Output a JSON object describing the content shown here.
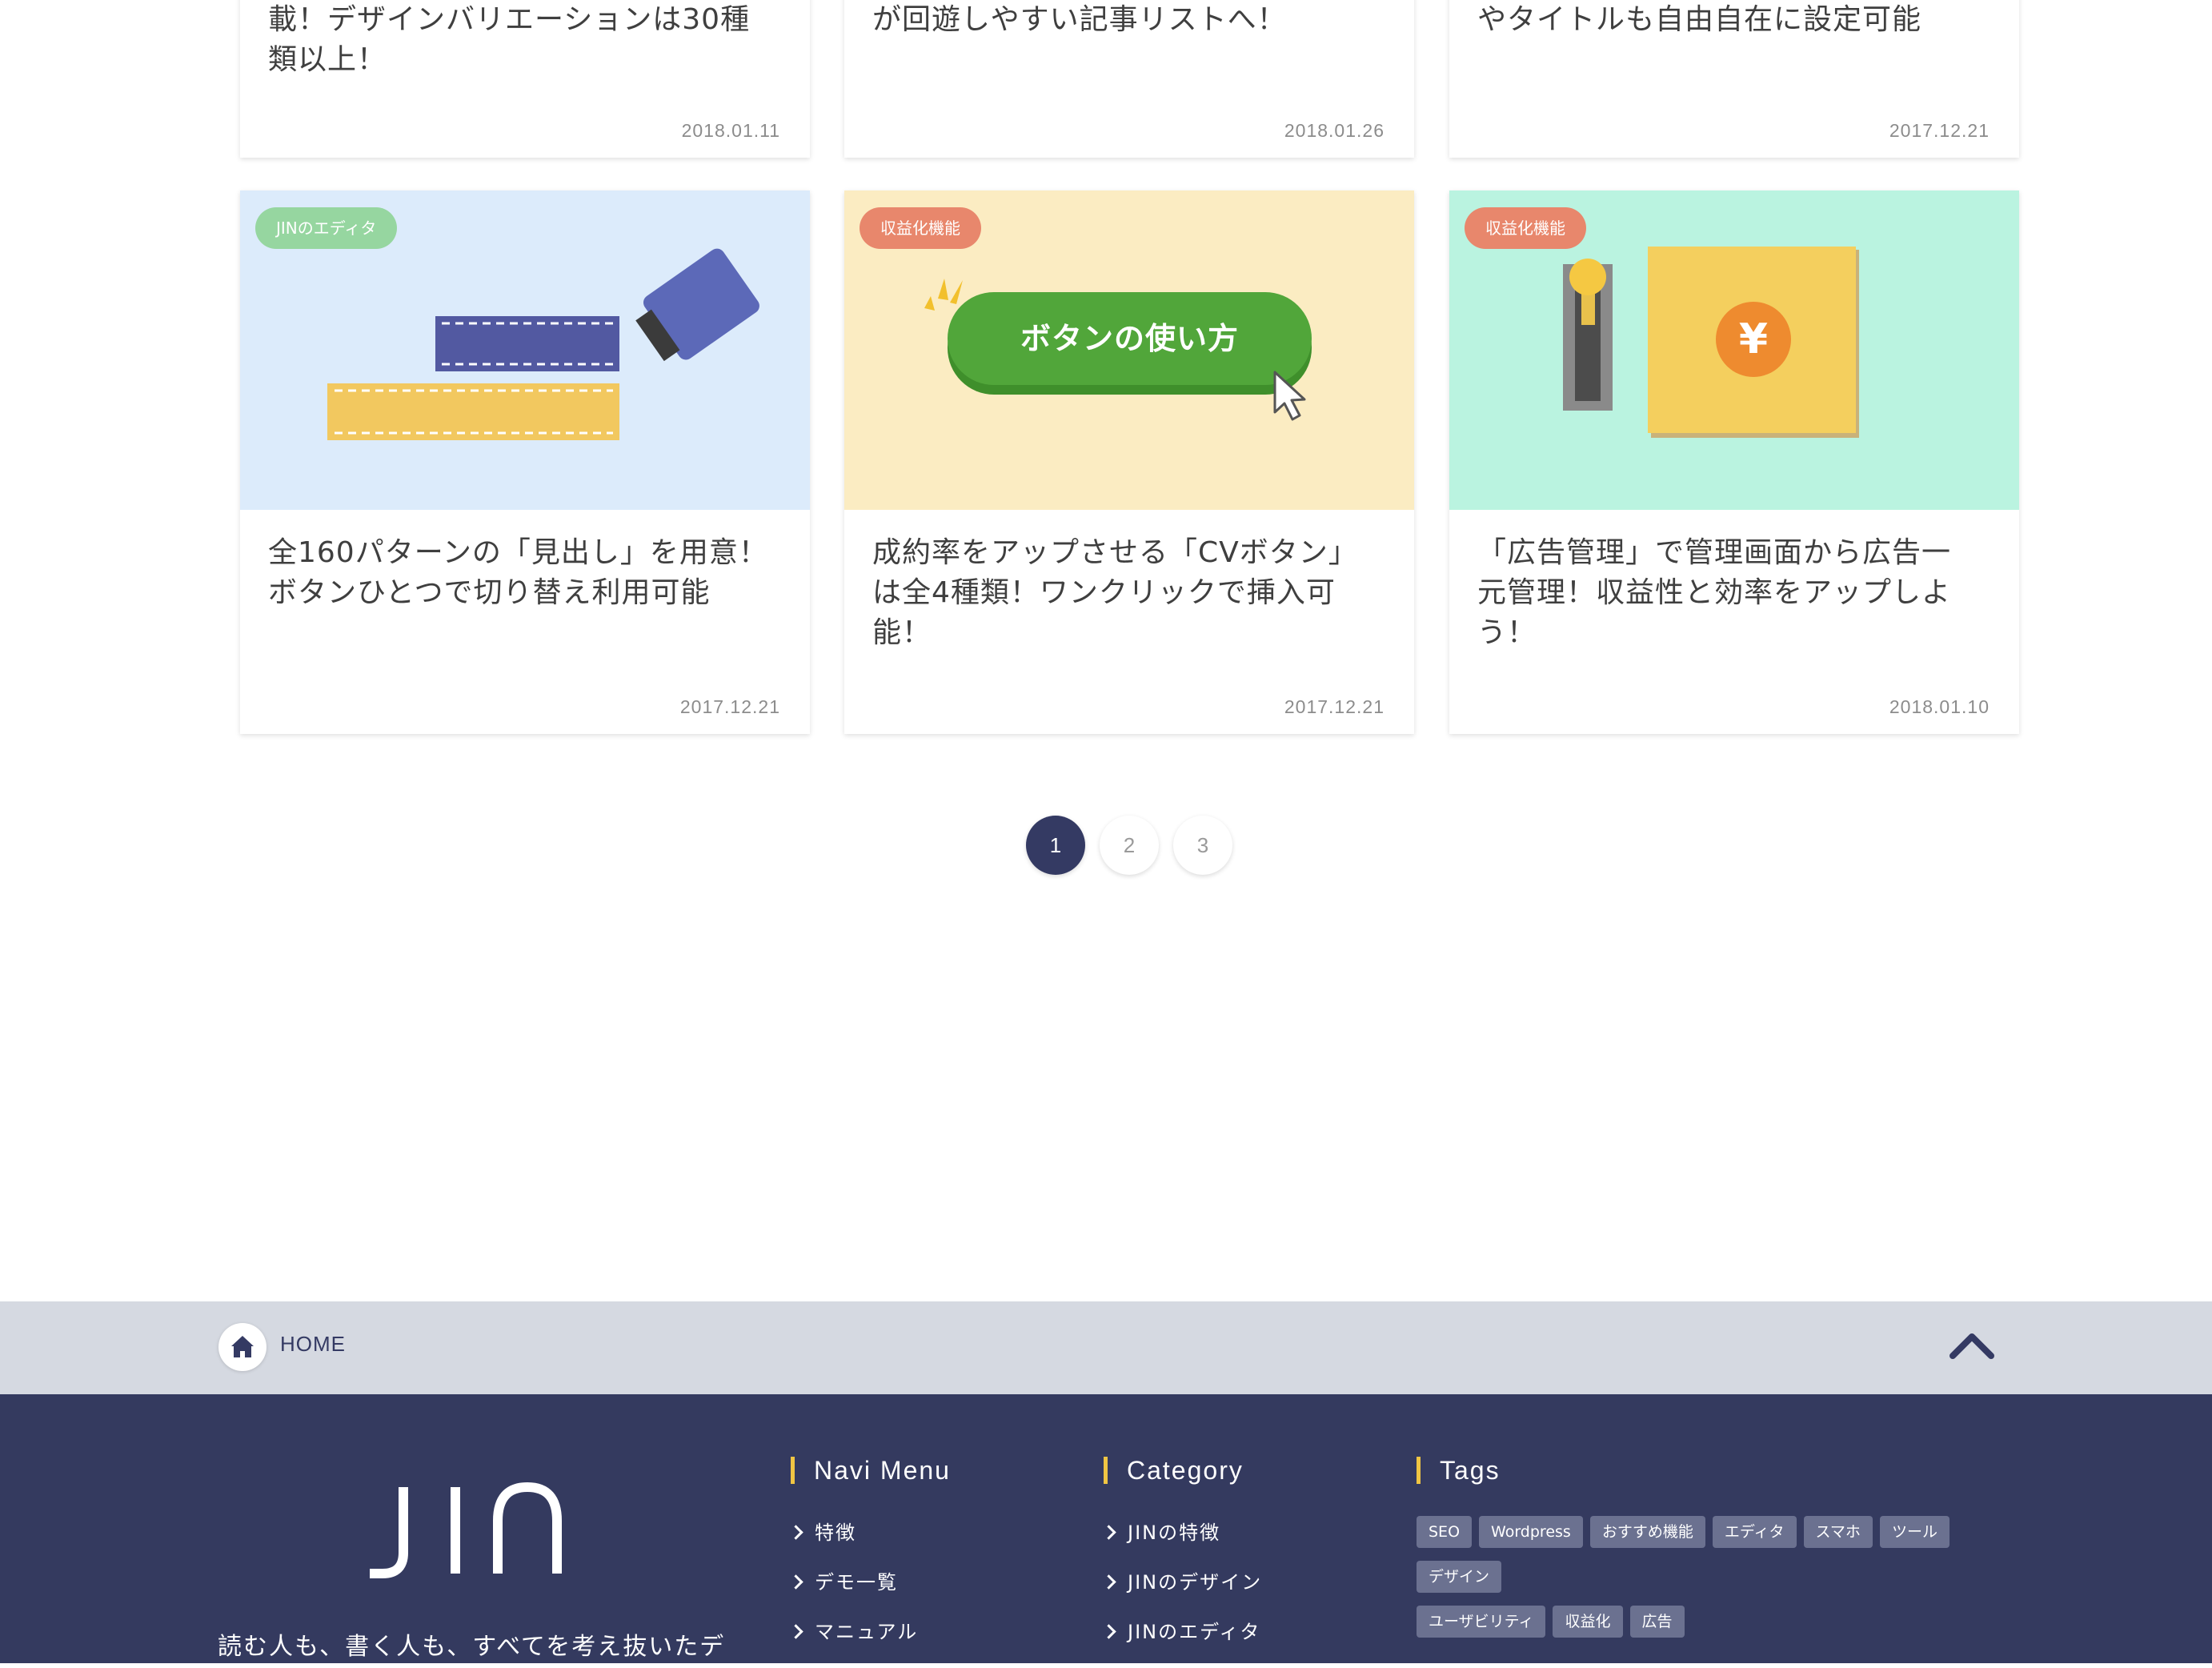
{
  "cards_top": [
    {
      "title": "載！デザインバリエーションは30種類以上！",
      "line1": "載！デザインバリエーションは30種",
      "line2": "類以上！",
      "date": "2018.01.11"
    },
    {
      "title": "が回遊しやすい記事リストへ！",
      "line1": "が回遊しやすい記事リストへ！",
      "date": "2018.01.26"
    },
    {
      "title": "やタイトルも自由自在に設定可能",
      "line1": "やタイトルも自由自在に設定可能",
      "date": "2017.12.21"
    }
  ],
  "cards": [
    {
      "badge": "JINのエディタ",
      "badge_color": "#96d6a0",
      "thumb_bg": "#dcebfb",
      "line1": "全160パターンの「見出し」を用意！",
      "line2": "ボタンひとつで切り替え利用可能",
      "line3": "",
      "date": "2017.12.21"
    },
    {
      "badge": "収益化機能",
      "badge_color": "#e8876c",
      "thumb_bg": "#fbecc2",
      "thumb_text": "ボタンの使い方",
      "line1": "成約率をアップさせる「CVボタン」",
      "line2": "は全4種類！ワンクリックで挿入可",
      "line3": "能！",
      "date": "2017.12.21"
    },
    {
      "badge": "収益化機能",
      "badge_color": "#e8876c",
      "thumb_bg": "#baf3e0",
      "thumb_text": "¥",
      "line1": "「広告管理」で管理画面から広告一",
      "line2": "元管理！収益性と効率をアップしよ",
      "line3": "う！",
      "date": "2018.01.10"
    }
  ],
  "pagination": {
    "pages": [
      "1",
      "2",
      "3"
    ],
    "current": "1"
  },
  "breadcrumb": {
    "home_label": "HOME"
  },
  "footer": {
    "logo": "JIN",
    "tagline": "読む人も、書く人も、すべてを考え抜いたデ",
    "navi": {
      "heading": "Navi Menu",
      "items": [
        "特徴",
        "デモ一覧",
        "マニュアル"
      ]
    },
    "category": {
      "heading": "Category",
      "items": [
        "JINの特徴",
        "JINのデザイン",
        "JINのエディタ"
      ]
    },
    "tags": {
      "heading": "Tags",
      "items": [
        "SEO",
        "Wordpress",
        "おすすめ機能",
        "エディタ",
        "スマホ",
        "ツール",
        "デザイン",
        "ユーザビリティ",
        "収益化",
        "広告"
      ]
    }
  },
  "colors": {
    "navy": "#343a63",
    "footer_bg": "#343a5f",
    "accent_yellow": "#f0c543"
  },
  "icons": {
    "home": "home-icon",
    "to_top": "chevron-up-icon",
    "list": "chevron-right-icon"
  }
}
